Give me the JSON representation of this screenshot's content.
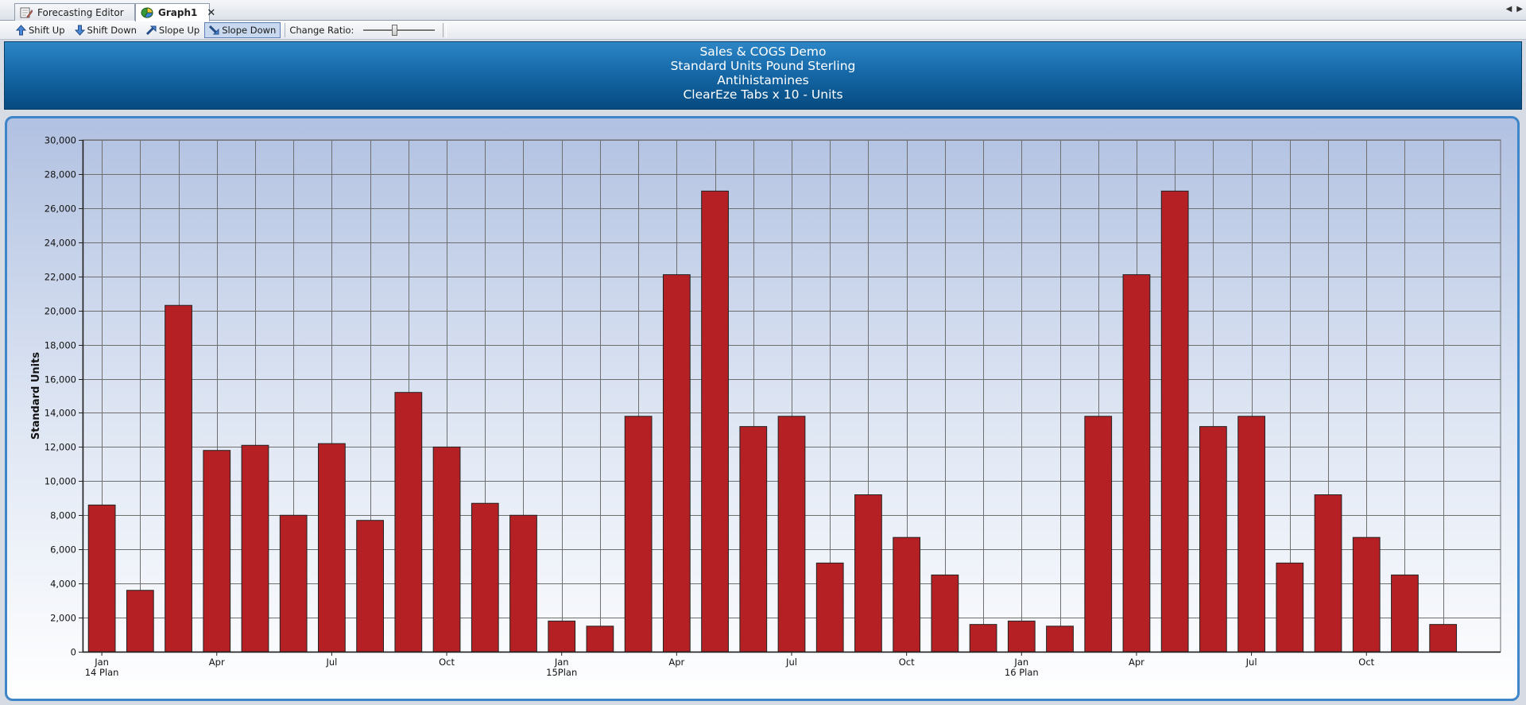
{
  "tabs": [
    {
      "label": "Forecasting Editor",
      "icon": "editor-icon",
      "active": false
    },
    {
      "label": "Graph1",
      "icon": "graph-icon",
      "active": true
    }
  ],
  "toolbar": {
    "shift_up": "Shift Up",
    "shift_down": "Shift Down",
    "slope_up": "Slope Up",
    "slope_down": "Slope Down",
    "change_ratio": "Change Ratio:"
  },
  "header": {
    "line1": "Sales & COGS Demo",
    "line2": "Standard Units Pound Sterling",
    "line3": "Antihistamines",
    "line4": "ClearEze Tabs x 10 - Units"
  },
  "colors": {
    "bar": "#b52024",
    "bar_stroke": "#222222",
    "grid": "#6f6f6f"
  },
  "chart_data": {
    "type": "bar",
    "ylabel": "Standard Units",
    "ylim": [
      0,
      30000
    ],
    "yticks": [
      0,
      2000,
      4000,
      6000,
      8000,
      10000,
      12000,
      14000,
      16000,
      18000,
      20000,
      22000,
      24000,
      26000,
      28000,
      30000
    ],
    "ytick_labels": [
      "0",
      "2,000",
      "4,000",
      "6,000",
      "8,000",
      "10,000",
      "12,000",
      "14,000",
      "16,000",
      "18,000",
      "20,000",
      "22,000",
      "24,000",
      "26,000",
      "28,000",
      "30,000"
    ],
    "x_labels": [
      {
        "index": 0,
        "lines": [
          "Jan",
          "14 Plan"
        ]
      },
      {
        "index": 3,
        "lines": [
          "Apr"
        ]
      },
      {
        "index": 6,
        "lines": [
          "Jul"
        ]
      },
      {
        "index": 9,
        "lines": [
          "Oct"
        ]
      },
      {
        "index": 12,
        "lines": [
          "Jan",
          "15Plan"
        ]
      },
      {
        "index": 15,
        "lines": [
          "Apr"
        ]
      },
      {
        "index": 18,
        "lines": [
          "Jul"
        ]
      },
      {
        "index": 21,
        "lines": [
          "Oct"
        ]
      },
      {
        "index": 24,
        "lines": [
          "Jan",
          "16 Plan"
        ]
      },
      {
        "index": 27,
        "lines": [
          "Apr"
        ]
      },
      {
        "index": 30,
        "lines": [
          "Jul"
        ]
      },
      {
        "index": 33,
        "lines": [
          "Oct"
        ]
      }
    ],
    "values": [
      8600,
      3600,
      20300,
      11800,
      12100,
      8000,
      12200,
      7700,
      15200,
      12000,
      8700,
      8000,
      1800,
      1500,
      13800,
      22100,
      27000,
      13200,
      13800,
      5200,
      9200,
      6700,
      4500,
      1600,
      1800,
      1500,
      13800,
      22100,
      27000,
      13200,
      13800,
      5200,
      9200,
      6700,
      4500,
      1600
    ]
  }
}
